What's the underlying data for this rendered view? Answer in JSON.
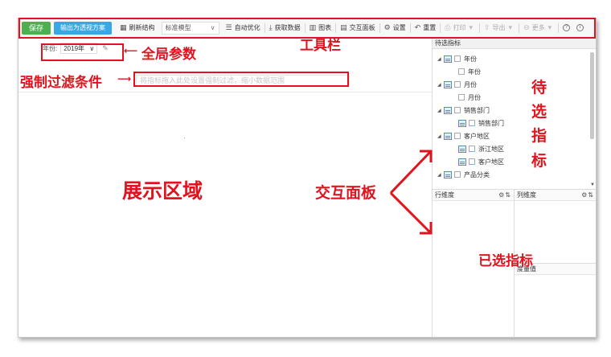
{
  "toolbar": {
    "save_label": "保存",
    "export_plan_label": "输出为透视方案",
    "refresh_structure_label": "刷新结构",
    "model_select_value": "标准模型",
    "auto_optimize_label": "自动优化",
    "fetch_data_label": "获取数据",
    "chart_label": "图表",
    "interaction_panel_label": "交互面板",
    "settings_label": "设置",
    "reset_label": "重置",
    "print_label": "打印",
    "export_label": "导出",
    "more_label": "更多",
    "help_icon_text": "?",
    "info_icon_text": "i"
  },
  "global_param": {
    "label": "年份:",
    "value": "2019年"
  },
  "filter": {
    "placeholder": "将指标拖入此处设置强制过滤，缩小数据范围"
  },
  "candidates": {
    "header": "待选指标",
    "items": [
      {
        "type": "group",
        "label": "年份"
      },
      {
        "type": "child",
        "label": "年份"
      },
      {
        "type": "group",
        "label": "月份"
      },
      {
        "type": "child",
        "label": "月份"
      },
      {
        "type": "group",
        "label": "销售部门"
      },
      {
        "type": "child-table",
        "label": "销售部门"
      },
      {
        "type": "group",
        "label": "客户地区"
      },
      {
        "type": "child-table",
        "label": "浙江地区"
      },
      {
        "type": "child-table",
        "label": "客户地区"
      },
      {
        "type": "group",
        "label": "产品分类"
      }
    ]
  },
  "panes": {
    "row_dimension": "行维度",
    "column_dimension": "列维度",
    "measure": "度量值"
  },
  "annotations": {
    "toolbar": "工具栏",
    "global_params": "全局参数",
    "forced_filter": "强制过滤条件",
    "display_area": "展示区域",
    "interaction_panel": "交互面板",
    "candidate_indicators": [
      "待",
      "选",
      "指",
      "标"
    ],
    "selected_indicators": "已选指标"
  },
  "colors": {
    "annotation": "#e0141e",
    "save_button": "#4caf50",
    "export_button": "#37a7e6"
  }
}
